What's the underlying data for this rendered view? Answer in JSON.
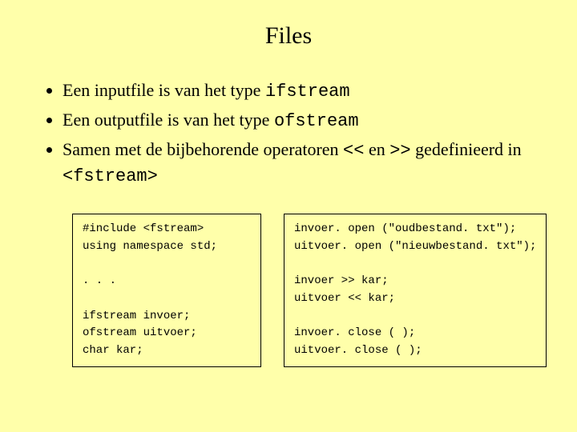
{
  "title": "Files",
  "bullets": [
    {
      "pre": "Een inputfile is van het type ",
      "code": "ifstream",
      "post": ""
    },
    {
      "pre": "Een outputfile is van het type ",
      "code": "ofstream",
      "post": ""
    },
    {
      "pre": "Samen met de bijbehorende operatoren ",
      "code": "<<",
      "mid": " en ",
      "code2": ">>",
      "post2_pre": " gedefinieerd in ",
      "code3": "<fstream>"
    }
  ],
  "code": {
    "left": "#include <fstream>\nusing namespace std;\n\n. . .\n\nifstream invoer;\nofstream uitvoer;\nchar kar;",
    "right": "invoer. open (\"oudbestand. txt\");\nuitvoer. open (\"nieuwbestand. txt\");\n\ninvoer >> kar;\nuitvoer << kar;\n\ninvoer. close ( );\nuitvoer. close ( );"
  }
}
